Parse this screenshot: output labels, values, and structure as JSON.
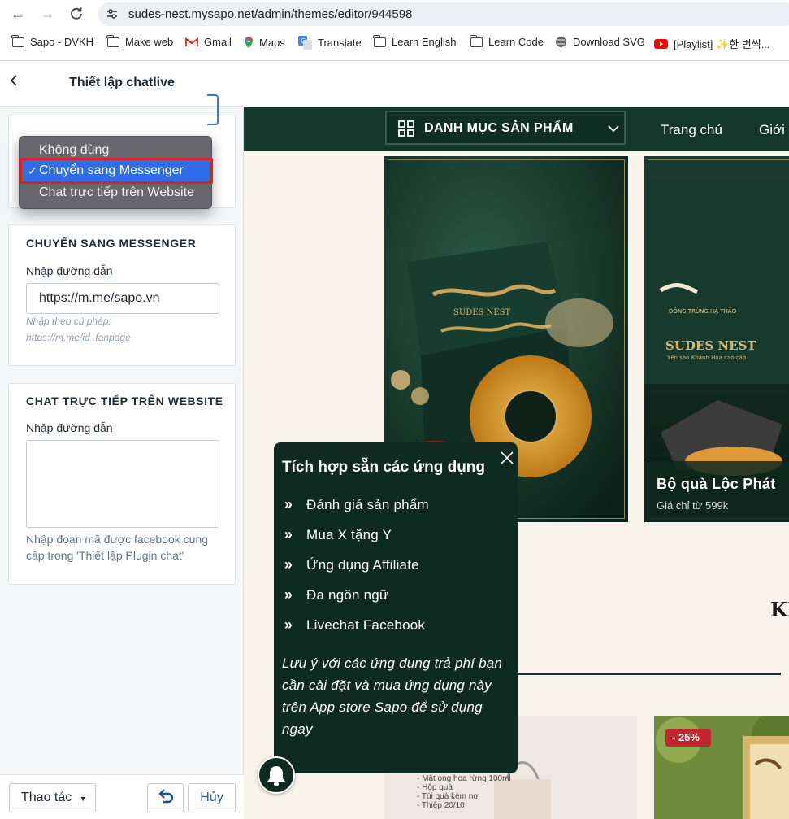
{
  "browser": {
    "url": "sudes-nest.mysapo.net/admin/themes/editor/944598",
    "bookmarks": [
      {
        "label": "Sapo - DVKH",
        "icon": "folder-icon"
      },
      {
        "label": "Make web",
        "icon": "folder-icon"
      },
      {
        "label": "Gmail",
        "icon": "gmail-icon"
      },
      {
        "label": "Maps",
        "icon": "maps-icon"
      },
      {
        "label": "Translate",
        "icon": "translate-icon"
      },
      {
        "label": "Learn English",
        "icon": "folder-icon"
      },
      {
        "label": "Learn Code",
        "icon": "folder-icon"
      },
      {
        "label": "Download SVG",
        "icon": "globe-icon"
      },
      {
        "label": "[Playlist] ✨한 번씩...",
        "icon": "youtube-icon"
      }
    ]
  },
  "panel": {
    "title": "Thiết lập chatlive",
    "dropdown": {
      "options": [
        "Không dùng",
        "Chuyển sang Messenger",
        "Chat trực tiếp trên Website"
      ],
      "selected": "Chuyển sang Messenger",
      "check": "✓"
    },
    "messenger": {
      "title": "CHUYỂN SANG MESSENGER",
      "label": "Nhập đường dẫn",
      "value": "https://m.me/sapo.vn",
      "hint1": "Nhập theo cú pháp:",
      "hint2": "https://m.me/id_fanpage"
    },
    "website": {
      "title": "CHAT TRỰC TIẾP TRÊN WEBSITE",
      "label": "Nhập đường dẫn",
      "value": "",
      "helper": "Nhập đoạn mã được facebook cung cấp trong 'Thiết lập Plugin chat'"
    },
    "footer": {
      "actions_label": "Thao tác",
      "cancel_label": "Hủy"
    }
  },
  "preview": {
    "category_button": "DANH MỤC SẢN PHẨM",
    "nav": [
      "Trang chủ",
      "Giới"
    ],
    "banner2": {
      "name": "Bộ quà Lộc Phát",
      "price": "Giá chỉ từ 599k"
    },
    "heading_fragment": "KI",
    "sale_badge": "- 25%",
    "product_list": [
      "- Mật ong hoa rừng 100ml",
      "- Hộp quà",
      "- Túi quà kèm nơ",
      "- Thiệp 20/10"
    ],
    "popup": {
      "title": "Tích hợp sẵn các ứng dụng",
      "items": [
        "Đánh giá sản phẩm",
        "Mua X tặng Y",
        "Ứng dụng Affiliate",
        "Đa ngôn ngữ",
        "Livechat Facebook"
      ],
      "note": "Lưu ý với các ứng dụng trả phí bạn cần cài đặt và mua ứng dụng này trên App store Sapo để sử dụng ngay"
    }
  }
}
